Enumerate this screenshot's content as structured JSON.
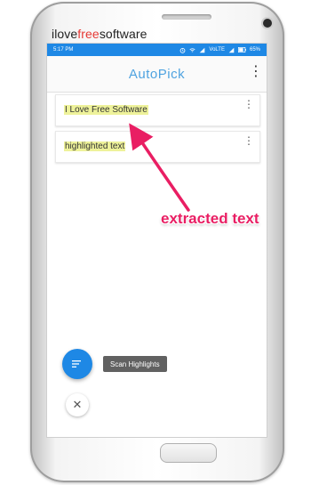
{
  "watermark": {
    "prefix": "ilove",
    "highlight": "free",
    "suffix": "software"
  },
  "status_bar": {
    "time": "5:17 PM",
    "network": "VoLTE",
    "battery": "65%"
  },
  "app": {
    "title": "AutoPick"
  },
  "cards": [
    {
      "text": "I Love Free Software"
    },
    {
      "text": "highlighted text"
    }
  ],
  "fab": {
    "label": "Scan Highlights"
  },
  "annotation": {
    "text": "extracted text"
  },
  "colors": {
    "accent": "#1e88e5",
    "highlight": "#eef29a",
    "annotation": "#e91e63"
  }
}
